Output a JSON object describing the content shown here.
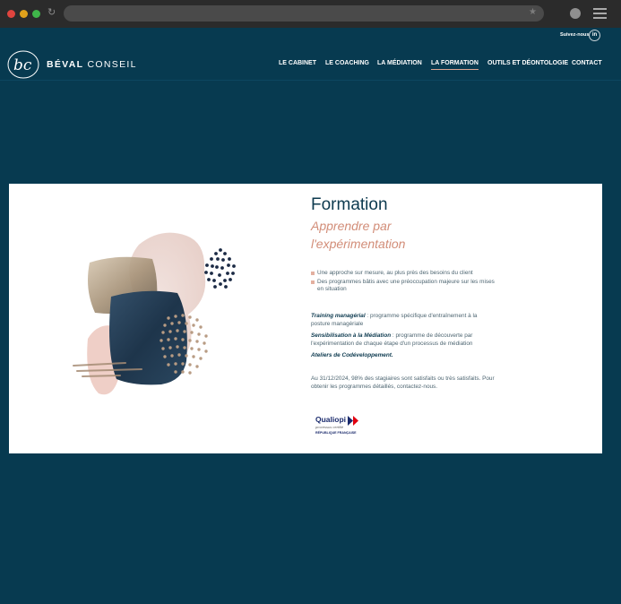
{
  "browser": {
    "controls": [
      "close-dot",
      "minimize-dot",
      "maximize-dot"
    ],
    "dot_colors": [
      "#e0443e",
      "#e0a11b",
      "#3fb64a"
    ],
    "icons": [
      "reload-icon",
      "bookmark-star-icon",
      "profile-icon",
      "menu-icon"
    ]
  },
  "header": {
    "follow_label": "Suivez-nous",
    "linkedin_label": "in",
    "logo_text": "bc",
    "brand_bold": "BÉVAL",
    "brand_light": " CONSEIL",
    "nav": [
      {
        "label": "LE CABINET",
        "active": false
      },
      {
        "label": "LE COACHING",
        "active": false
      },
      {
        "label": "LA MÉDIATION",
        "active": false
      },
      {
        "label": "LA FORMATION",
        "active": true
      },
      {
        "label": "OUTILS ET DÉONTOLOGIE",
        "active": false
      },
      {
        "label": "CONTACT",
        "active": false
      }
    ]
  },
  "formation": {
    "title": "Formation",
    "subtitle_line1": "Apprendre par",
    "subtitle_line2": "l'expérimentation",
    "bullets": [
      "Une approche sur mesure, au plus près des besoins du client",
      "Des programmes bâtis avec une préoccupation majeure sur les mises en situation"
    ],
    "programs": [
      {
        "name": "Training managérial",
        "desc": " : programme spécifique d'entraînement à la posture managériale"
      },
      {
        "name": "Sensibilisation à la Médiation",
        "desc": " : programme de découverte par l'expérimentation de chaque étape d'un processus de médiation"
      },
      {
        "name": "Ateliers de Codéveloppement.",
        "desc": ""
      }
    ],
    "stats": "Au 31/12/2024, 98% des stagiaires sont satisfaits ou très satisfaits. Pour obtenir les programmes détaillés, contactez-nous.",
    "certification": {
      "name": "Qualiopi",
      "subtitle": "processus certifié",
      "authority": "RÉPUBLIQUE FRANÇAISE"
    }
  },
  "colors": {
    "page_bg": "#073a50",
    "accent": "#d28d78",
    "title": "#0d3a4f"
  }
}
